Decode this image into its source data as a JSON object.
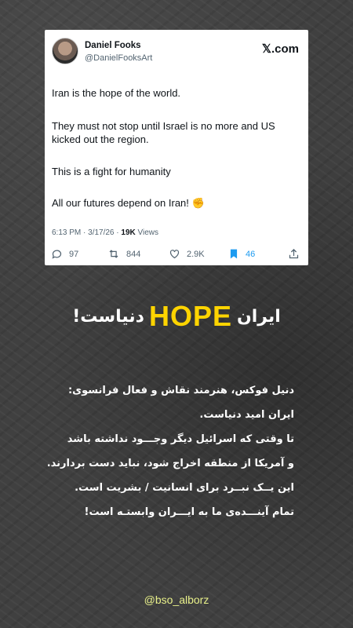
{
  "tweet": {
    "author_name": "Daniel Fooks",
    "author_handle": "@DanielFooksArt",
    "platform_label": "𝕏.com",
    "paragraphs": [
      "Iran is the hope of the world.",
      "They must not stop until Israel is no more and US kicked out the region.",
      "This is a fight for humanity",
      "All our futures depend on Iran! ✊"
    ],
    "time": "6:13 PM · 3/17/26 · ",
    "views_count": "19K",
    "views_label": " Views",
    "replies": "97",
    "reposts": "844",
    "likes": "2.9K",
    "bookmarks": "46"
  },
  "headline": {
    "before": "ایران",
    "highlight": "HOPE",
    "after": "دنیاست!"
  },
  "translation": {
    "lines": [
      "دنیل فوکس، هنرمند نقاش و فعال فرانسوی:",
      "ایران امید دنیاست.",
      "تا وقتی که اسرائیل دیگر وجـــود نداشته باشد",
      "و آمریکا از منطقه اخراج شود، نباید دست بردارند.",
      "این یــک نبــرد برای انسانیت / بشریت است.",
      "تمام آینـــده‌ی ما به ایـــران وابستـه است!"
    ]
  },
  "signature": "@bso_alborz",
  "colors": {
    "accent_yellow": "#ffd400",
    "bookmark_blue": "#1d9bf0",
    "background": "#404040"
  }
}
